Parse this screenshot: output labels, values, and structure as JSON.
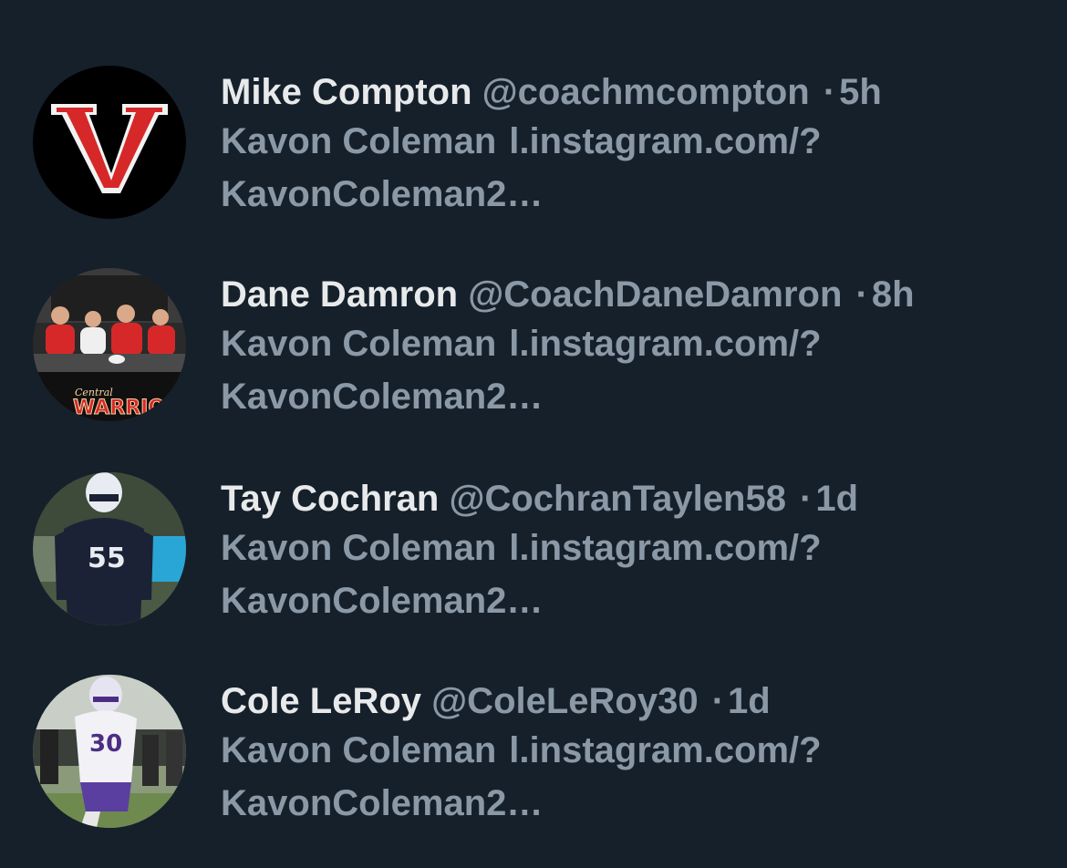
{
  "tweets": [
    {
      "display_name": "Mike Compton",
      "handle": "@coachmcompton",
      "separator": "·",
      "time": "5h",
      "text_line1_name": "Kavon Coleman",
      "text_line1_link": "l.instagram.com/?",
      "text_line2": "KavonColeman2…",
      "avatar_icon": "red-v-logo-icon"
    },
    {
      "display_name": "Dane Damron",
      "handle": "@CoachDaneDamron",
      "separator": "·",
      "time": "8h",
      "text_line1_name": "Kavon Coleman",
      "text_line1_link": "l.instagram.com/?",
      "text_line2": "KavonColeman2…",
      "avatar_icon": "signing-photo-icon",
      "avatar_logo_text_small": "Central",
      "avatar_logo_text": "WARRIORS"
    },
    {
      "display_name": "Tay Cochran",
      "handle": "@CochranTaylen58",
      "separator": "·",
      "time": "1d",
      "text_line1_name": "Kavon Coleman",
      "text_line1_link": "l.instagram.com/?",
      "text_line2": "KavonColeman2…",
      "avatar_icon": "football-player-55-icon",
      "avatar_jersey": "55"
    },
    {
      "display_name": "Cole LeRoy",
      "handle": "@ColeLeRoy30",
      "separator": "·",
      "time": "1d",
      "text_line1_name": "Kavon Coleman",
      "text_line1_link": "l.instagram.com/?",
      "text_line2": "KavonColeman2…",
      "avatar_icon": "football-player-30-icon",
      "avatar_jersey": "30"
    }
  ],
  "colors": {
    "background": "#15202b",
    "primary_text": "#e7e9ea",
    "secondary_text": "#8b98a5",
    "accent_red": "#d62828"
  }
}
